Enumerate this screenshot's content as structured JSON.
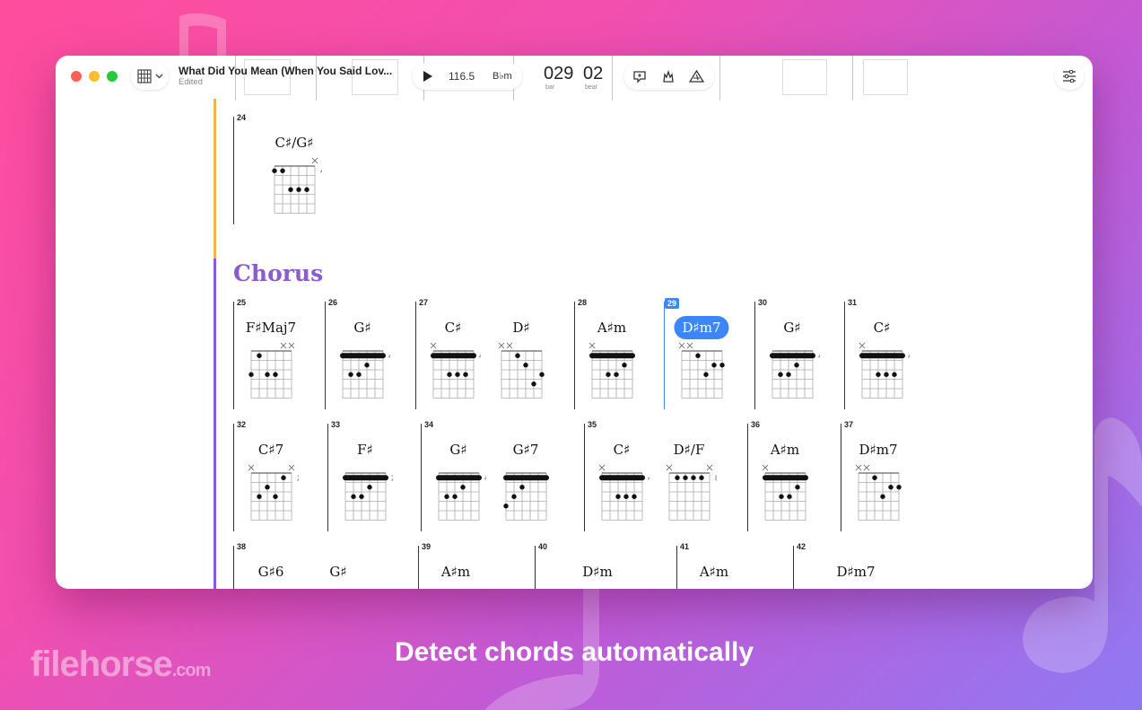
{
  "app": {
    "song_title": "What Did You Mean (When You Said Lov...",
    "status": "Edited",
    "tempo": "116.5",
    "key": "B♭m",
    "bar": "029",
    "beat": "02",
    "bar_label": "bar",
    "beat_label": "beat"
  },
  "section_name": "Chorus",
  "caption": "Detect chords automatically",
  "watermark": {
    "main": "filehorse",
    "suffix": ".com"
  },
  "colors": {
    "accent": "#3d86f5",
    "section": "#8a5cd0",
    "verse_marker": "#f5b24a"
  },
  "bars": [
    {
      "num": "24",
      "chords": [
        {
          "name": "C♯/G♯",
          "fret": "4",
          "barre": false,
          "mute": [
            5
          ],
          "dots": [
            [
              0,
              1
            ],
            [
              1,
              1
            ],
            [
              2,
              3
            ],
            [
              3,
              3
            ],
            [
              4,
              3
            ]
          ]
        }
      ]
    },
    {
      "num": "25",
      "chords": [
        {
          "name": "F♯Maj7",
          "fret": "",
          "barre": false,
          "mute": [
            4,
            5
          ],
          "dots": [
            [
              0,
              3
            ],
            [
              1,
              1
            ],
            [
              2,
              3
            ],
            [
              3,
              3
            ]
          ]
        }
      ]
    },
    {
      "num": "26",
      "chords": [
        {
          "name": "G♯",
          "fret": "4",
          "barre": true,
          "mute": [],
          "dots": [
            [
              1,
              3
            ],
            [
              2,
              3
            ],
            [
              3,
              2
            ]
          ]
        }
      ]
    },
    {
      "num": "27",
      "chords": [
        {
          "name": "C♯",
          "fret": "4",
          "barre": true,
          "mute": [
            0
          ],
          "dots": [
            [
              2,
              3
            ],
            [
              3,
              3
            ],
            [
              4,
              3
            ]
          ]
        },
        {
          "name": "D♯",
          "fret": "",
          "barre": false,
          "mute": [
            0,
            1
          ],
          "dots": [
            [
              2,
              1
            ],
            [
              3,
              2
            ],
            [
              4,
              4
            ],
            [
              5,
              3
            ]
          ]
        }
      ]
    },
    {
      "num": "28",
      "chords": [
        {
          "name": "A♯m",
          "fret": "",
          "barre": true,
          "mute": [
            0
          ],
          "dots": [
            [
              2,
              3
            ],
            [
              3,
              3
            ],
            [
              4,
              2
            ]
          ]
        }
      ]
    },
    {
      "num": "29",
      "active": true,
      "chords": [
        {
          "name": "D♯m7",
          "fret": "",
          "barre": false,
          "mute": [
            0,
            1
          ],
          "dots": [
            [
              2,
              1
            ],
            [
              3,
              3
            ],
            [
              4,
              2
            ],
            [
              5,
              2
            ]
          ]
        }
      ]
    },
    {
      "num": "30",
      "chords": [
        {
          "name": "G♯",
          "fret": "4",
          "barre": true,
          "mute": [],
          "dots": [
            [
              1,
              3
            ],
            [
              2,
              3
            ],
            [
              3,
              2
            ]
          ]
        }
      ]
    },
    {
      "num": "31",
      "chords": [
        {
          "name": "C♯",
          "fret": "4",
          "barre": true,
          "mute": [
            0
          ],
          "dots": [
            [
              2,
              3
            ],
            [
              3,
              3
            ],
            [
              4,
              3
            ]
          ]
        }
      ]
    },
    {
      "num": "32",
      "chords": [
        {
          "name": "C♯7",
          "fret": "2",
          "barre": false,
          "mute": [
            0,
            5
          ],
          "dots": [
            [
              1,
              3
            ],
            [
              2,
              2
            ],
            [
              3,
              3
            ],
            [
              4,
              1
            ]
          ]
        }
      ]
    },
    {
      "num": "33",
      "chords": [
        {
          "name": "F♯",
          "fret": "2",
          "barre": true,
          "mute": [],
          "dots": [
            [
              1,
              3
            ],
            [
              2,
              3
            ],
            [
              3,
              2
            ]
          ]
        }
      ]
    },
    {
      "num": "34",
      "chords": [
        {
          "name": "G♯",
          "fret": "4",
          "barre": true,
          "mute": [],
          "dots": [
            [
              1,
              3
            ],
            [
              2,
              3
            ],
            [
              3,
              2
            ]
          ]
        },
        {
          "name": "G♯7",
          "fret": "",
          "barre": true,
          "mute": [],
          "dots": [
            [
              0,
              4
            ],
            [
              1,
              3
            ],
            [
              2,
              2
            ]
          ]
        }
      ]
    },
    {
      "num": "35",
      "chords": [
        {
          "name": "C♯",
          "fret": "4",
          "barre": true,
          "mute": [
            0
          ],
          "dots": [
            [
              2,
              3
            ],
            [
              3,
              3
            ],
            [
              4,
              3
            ]
          ]
        },
        {
          "name": "D♯/F",
          "fret": "8",
          "barre": false,
          "mute": [
            0,
            5
          ],
          "dots": [
            [
              1,
              1
            ],
            [
              2,
              1
            ],
            [
              3,
              1
            ],
            [
              4,
              1
            ]
          ]
        }
      ]
    },
    {
      "num": "36",
      "chords": [
        {
          "name": "A♯m",
          "fret": "",
          "barre": true,
          "mute": [
            0
          ],
          "dots": [
            [
              2,
              3
            ],
            [
              3,
              3
            ],
            [
              4,
              2
            ]
          ]
        }
      ]
    },
    {
      "num": "37",
      "chords": [
        {
          "name": "D♯m7",
          "fret": "",
          "barre": false,
          "mute": [
            0,
            1
          ],
          "dots": [
            [
              2,
              1
            ],
            [
              3,
              3
            ],
            [
              4,
              2
            ],
            [
              5,
              2
            ]
          ]
        }
      ]
    },
    {
      "num": "38",
      "chords": [
        {
          "name": "G♯6"
        },
        {
          "name": "G♯"
        }
      ]
    },
    {
      "num": "39",
      "chords": [
        {
          "name": "A♯m"
        }
      ]
    },
    {
      "num": "40",
      "chords": [
        {
          "name": "D♯m"
        }
      ]
    },
    {
      "num": "41",
      "chords": [
        {
          "name": "A♯m"
        }
      ]
    },
    {
      "num": "42",
      "chords": [
        {
          "name": "D♯m7"
        }
      ]
    }
  ]
}
